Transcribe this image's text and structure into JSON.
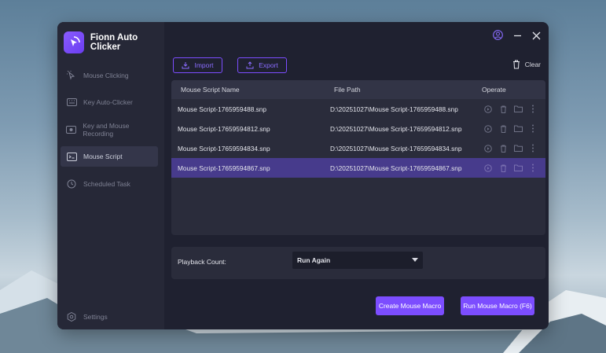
{
  "app": {
    "title": "Fionn Auto Clicker"
  },
  "sidebar": {
    "items": [
      {
        "label": "Mouse Clicking",
        "icon": "cursor-click-icon",
        "active": false
      },
      {
        "label": "Key Auto-Clicker",
        "icon": "keyboard-icon",
        "active": false
      },
      {
        "label": "Key and Mouse Recording",
        "icon": "recording-icon",
        "active": false
      },
      {
        "label": "Mouse Script",
        "icon": "script-icon",
        "active": true
      },
      {
        "label": "Scheduled Task",
        "icon": "clock-icon",
        "active": false
      }
    ],
    "settings_label": "Settings"
  },
  "toolbar": {
    "import_label": "Import",
    "export_label": "Export",
    "clear_label": "Clear"
  },
  "table": {
    "headers": {
      "name": "Mouse Script Name",
      "path": "File Path",
      "operate": "Operate"
    },
    "rows": [
      {
        "name": "Mouse Script-1765959488.snp",
        "path": "D:\\20251027\\Mouse Script-1765959488.snp"
      },
      {
        "name": "Mouse Script-17659594812.snp",
        "path": "D:\\20251027\\Mouse Script-17659594812.snp"
      },
      {
        "name": "Mouse Script-17659594834.snp",
        "path": "D:\\20251027\\Mouse Script-17659594834.snp"
      },
      {
        "name": "Mouse Script-17659594867.snp",
        "path": "D:\\20251027\\Mouse Script-17659594867.snp"
      }
    ],
    "selected_row": 3
  },
  "playback": {
    "label": "Playback Count:",
    "value": "Run Again"
  },
  "actions": {
    "create_label": "Create Mouse Macro",
    "run_label": "Run Mouse Macro (F6)"
  },
  "colors": {
    "accent": "#7c4dff",
    "window_bg": "#1f2130",
    "sidebar_bg": "#262837",
    "selected_row": "#473b8c"
  }
}
